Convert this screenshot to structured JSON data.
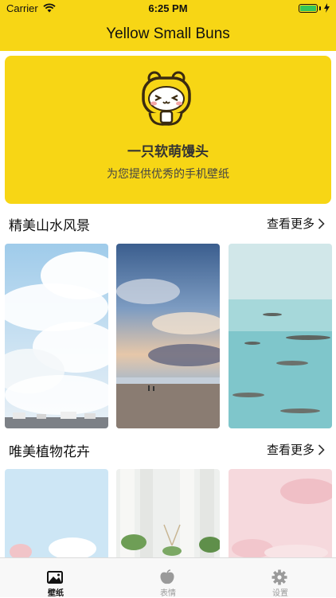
{
  "status_bar": {
    "carrier": "Carrier",
    "time": "6:25 PM"
  },
  "nav": {
    "title": "Yellow Small Buns"
  },
  "hero": {
    "title": "一只软萌馒头",
    "subtitle": "为您提供优秀的手机壁纸"
  },
  "sections": [
    {
      "title": "精美山水风景",
      "more_label": "查看更多"
    },
    {
      "title": "唯美植物花卉",
      "more_label": "查看更多"
    }
  ],
  "tabs": [
    {
      "label": "壁纸",
      "icon": "image-icon",
      "active": true
    },
    {
      "label": "表情",
      "icon": "apple-icon",
      "active": false
    },
    {
      "label": "设置",
      "icon": "gear-icon",
      "active": false
    }
  ],
  "colors": {
    "brand_yellow": "#F7D615",
    "tab_active": "#111111",
    "tab_inactive": "#9A9A9A"
  }
}
